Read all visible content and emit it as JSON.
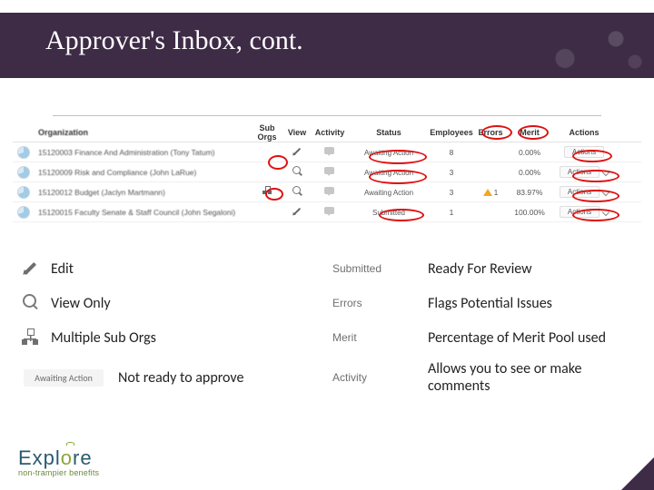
{
  "title": "Approver's Inbox, cont.",
  "headers": {
    "org": "Organization",
    "sub": "Sub Orgs",
    "view": "View",
    "activity": "Activity",
    "status": "Status",
    "employees": "Employees",
    "errors": "Errors",
    "merit": "Merit",
    "actions": "Actions"
  },
  "rows": [
    {
      "org": "15120003 Finance And Administration (Tony Tatum)",
      "view": "pencil",
      "status": "Awaiting Action",
      "emp": "8",
      "err": "",
      "merit": "0.00%",
      "action": "Actions"
    },
    {
      "org": "15120009 Risk and Compliance (John LaRue)",
      "view": "mag",
      "status": "Awaiting Action",
      "emp": "3",
      "err": "",
      "merit": "0.00%",
      "action": "Actions"
    },
    {
      "org": "15120012 Budget (Jaclyn Martmann)",
      "sub": "tree",
      "view": "mag",
      "status": "Awaiting Action",
      "emp": "3",
      "err": "warn",
      "errn": "1",
      "merit": "83.97%",
      "action": "Actions"
    },
    {
      "org": "15120015 Faculty Senate & Staff Council (John Segaloni)",
      "view": "pencil",
      "status": "Submitted",
      "emp": "1",
      "err": "",
      "merit": "100.00%",
      "action": "Actions"
    }
  ],
  "legend": {
    "left": [
      {
        "icon": "pencil",
        "label": "Edit"
      },
      {
        "icon": "mag",
        "label": "View Only"
      },
      {
        "icon": "tree",
        "label": "Multiple Sub Orgs"
      },
      {
        "icon": "await",
        "label": "Not ready to approve"
      }
    ],
    "right": [
      {
        "badge": "Submitted",
        "label": "Ready For Review"
      },
      {
        "badge": "Errors",
        "label": "Flags Potential Issues"
      },
      {
        "badge": "Merit",
        "label": "Percentage of Merit Pool used"
      },
      {
        "badge": "Activity",
        "label": "Allows you to see or make comments"
      }
    ]
  },
  "logo": {
    "text": "Expl",
    "o": "o",
    "text2": "re",
    "sub": "non-trampier benefits"
  },
  "chart_data": {
    "type": "table",
    "title": "Approver Inbox rows",
    "columns": [
      "Organization",
      "Status",
      "Employees",
      "Errors",
      "Merit"
    ],
    "rows": [
      [
        "15120003 Finance And Administration (Tony Tatum)",
        "Awaiting Action",
        8,
        0,
        0.0
      ],
      [
        "15120009 Risk and Compliance (John LaRue)",
        "Awaiting Action",
        3,
        0,
        0.0
      ],
      [
        "15120012 Budget (Jaclyn Martmann)",
        "Awaiting Action",
        3,
        1,
        83.97
      ],
      [
        "15120015 Faculty Senate & Staff Council (John Segaloni)",
        "Submitted",
        1,
        0,
        100.0
      ]
    ]
  }
}
